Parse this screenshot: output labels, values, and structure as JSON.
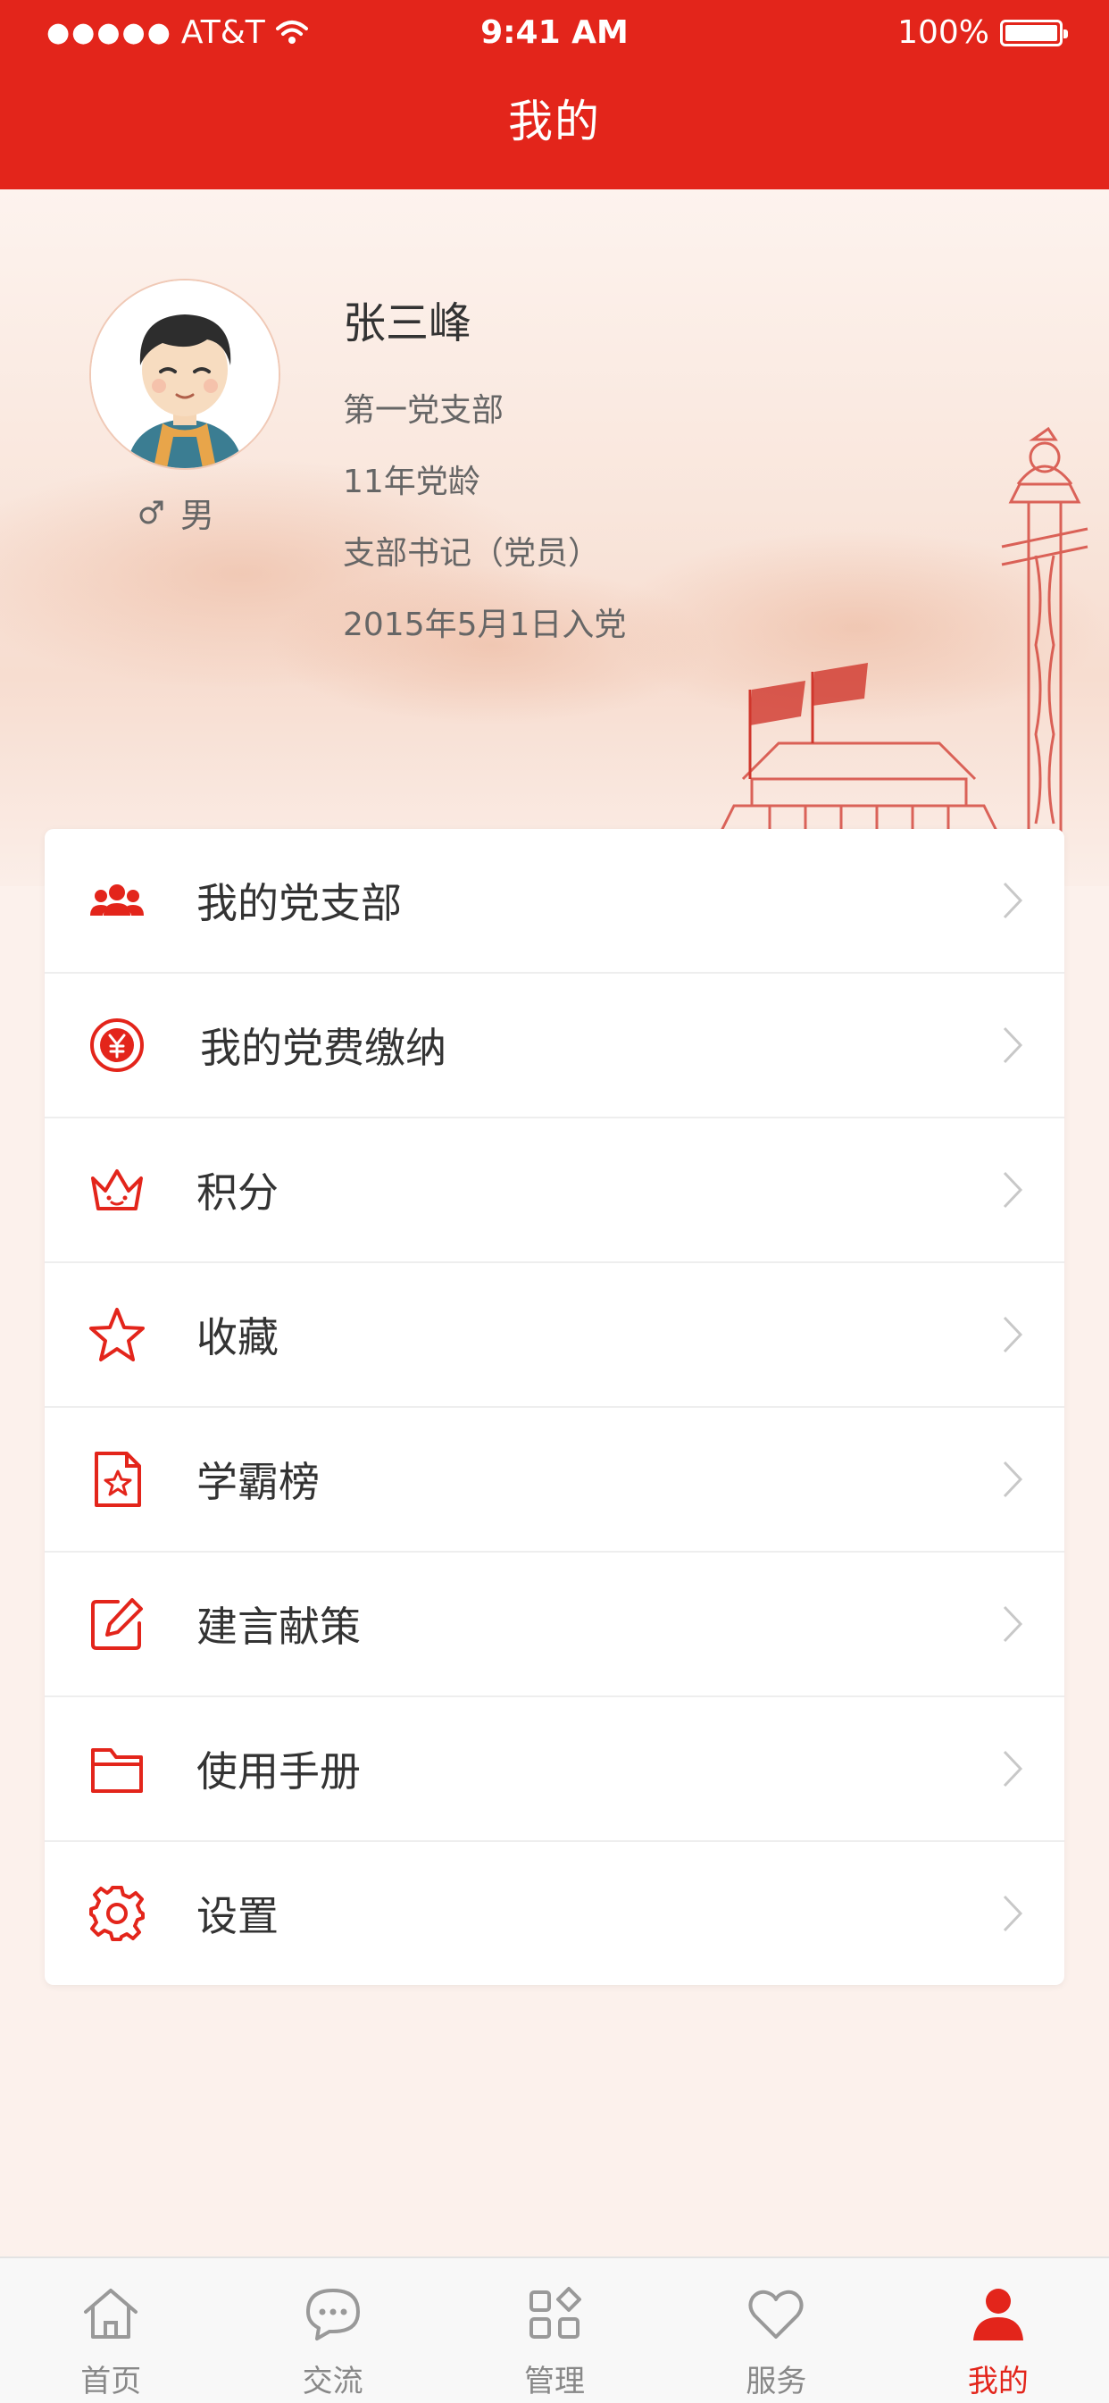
{
  "status_bar": {
    "signal": "●●●●●",
    "carrier": "AT&T",
    "time": "9:41 AM",
    "battery": "100%"
  },
  "header": {
    "title": "我的"
  },
  "profile": {
    "name": "张三峰",
    "gender": "男",
    "branch": "第一党支部",
    "party_age": "11年党龄",
    "role": "支部书记（党员）",
    "joined": "2015年5月1日入党"
  },
  "menu": {
    "items": [
      {
        "label": "我的党支部",
        "icon": "people-icon"
      },
      {
        "label": "我的党费缴纳",
        "icon": "yuan-icon"
      },
      {
        "label": "积分",
        "icon": "crown-icon"
      },
      {
        "label": "收藏",
        "icon": "star-icon"
      },
      {
        "label": "学霸榜",
        "icon": "star-document-icon"
      },
      {
        "label": "建言献策",
        "icon": "edit-icon"
      },
      {
        "label": "使用手册",
        "icon": "folder-icon"
      },
      {
        "label": "设置",
        "icon": "gear-icon"
      }
    ]
  },
  "tabbar": {
    "tabs": [
      {
        "label": "首页",
        "icon": "home-icon"
      },
      {
        "label": "交流",
        "icon": "chat-icon"
      },
      {
        "label": "管理",
        "icon": "grid-icon"
      },
      {
        "label": "服务",
        "icon": "heart-icon"
      },
      {
        "label": "我的",
        "icon": "person-icon",
        "active": true
      }
    ]
  },
  "colors": {
    "primary": "#e3251b",
    "background": "#fcf1ec",
    "text": "#333333",
    "secondary_text": "#666666"
  }
}
